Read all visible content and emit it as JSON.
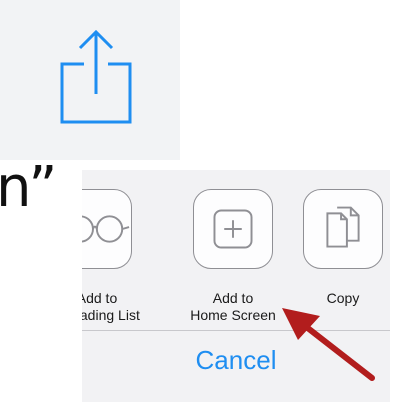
{
  "quote_fragment": "n”",
  "share_sheet": {
    "actions": [
      {
        "line1": "Add to",
        "line2": "Reading List",
        "icon": "glasses-icon"
      },
      {
        "line1": "Add to",
        "line2": "Home Screen",
        "icon": "plus-square-icon"
      },
      {
        "line1": "Copy",
        "line2": "",
        "icon": "copy-documents-icon"
      }
    ],
    "cancel_label": "Cancel"
  },
  "colors": {
    "accent_blue": "#1f8ef1",
    "arrow_red": "#b21d1d"
  }
}
